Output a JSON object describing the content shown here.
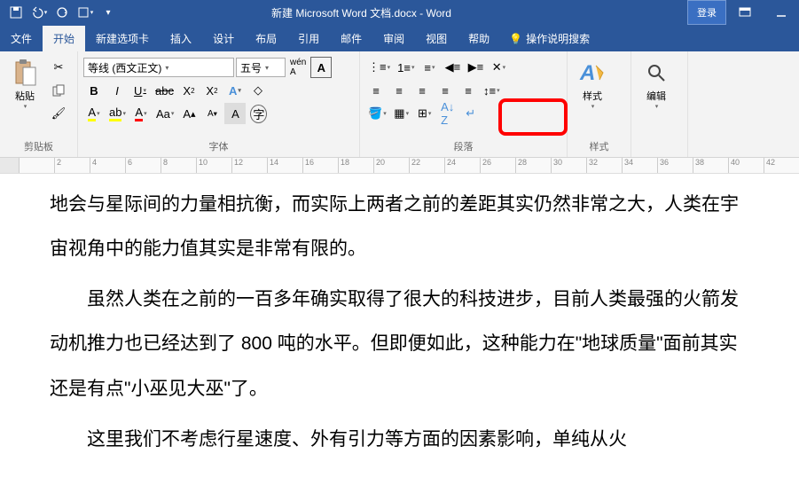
{
  "titlebar": {
    "title": "新建 Microsoft Word 文档.docx - Word",
    "login": "登录"
  },
  "tabs": {
    "file": "文件",
    "home": "开始",
    "newtab": "新建选项卡",
    "insert": "插入",
    "design": "设计",
    "layout": "布局",
    "references": "引用",
    "mailings": "邮件",
    "review": "审阅",
    "view": "视图",
    "help": "帮助",
    "tellme": "操作说明搜索"
  },
  "ribbon": {
    "clipboard": {
      "paste": "粘贴",
      "label": "剪贴板"
    },
    "font": {
      "name": "等线 (西文正文)",
      "size": "五号",
      "label": "字体"
    },
    "paragraph": {
      "label": "段落"
    },
    "styles": {
      "big": "样式",
      "label": "样式"
    },
    "editing": {
      "label": "编辑"
    }
  },
  "ruler_marks": [
    "",
    "2",
    "4",
    "6",
    "8",
    "10",
    "12",
    "14",
    "16",
    "18",
    "20",
    "22",
    "24",
    "26",
    "28",
    "30",
    "32",
    "34",
    "36",
    "38",
    "40",
    "42"
  ],
  "doc": {
    "p1": "地会与星际间的力量相抗衡，而实际上两者之前的差距其实仍然非常之大，人类在宇宙视角中的能力值其实是非常有限的。",
    "p2": "虽然人类在之前的一百多年确实取得了很大的科技进步，目前人类最强的火箭发动机推力也已经达到了 800 吨的水平。但即便如此，这种能力在\"地球质量\"面前其实还是有点\"小巫见大巫\"了。",
    "p3": "这里我们不考虑行星速度、外有引力等方面的因素影响，单纯从火"
  }
}
